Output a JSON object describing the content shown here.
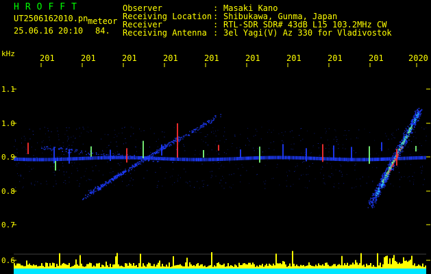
{
  "header": {
    "title": "HROFFT",
    "filename": "UT2506162010.pn",
    "mode": "meteor",
    "timestamp": "25.06.16 20:10",
    "counter": "84."
  },
  "meta": {
    "separator": ":",
    "observer": {
      "key": "Observer",
      "value": "Masaki Kano"
    },
    "location": {
      "key": "Receiving Location",
      "value": "Shibukawa, Gunma, Japan"
    },
    "receiver": {
      "key": "Receiver",
      "value": "RTL-SDR SDR# 43dB L15 103.2MHz CW"
    },
    "antenna": {
      "key": "Receiving Antenna",
      "value": "3el Yagi(V) Az 330 for Vladivostok"
    }
  },
  "axis": {
    "unit": "kHz",
    "y_ticks": [
      "1.1",
      "1.0",
      "0.9",
      "0.8",
      "0.7",
      "0.6"
    ],
    "x_ticks": [
      "201",
      "201",
      "201",
      "201",
      "201",
      "201",
      "201",
      "201",
      "201",
      "2020"
    ]
  },
  "colors": {
    "background": "#000000",
    "text": "#ffff00",
    "title": "#00ff00",
    "signal_blue": "#1e3cff",
    "signal_hot": "#ff3030",
    "level_meter": "#ffff00",
    "noise_floor": "#00e5ff"
  }
}
